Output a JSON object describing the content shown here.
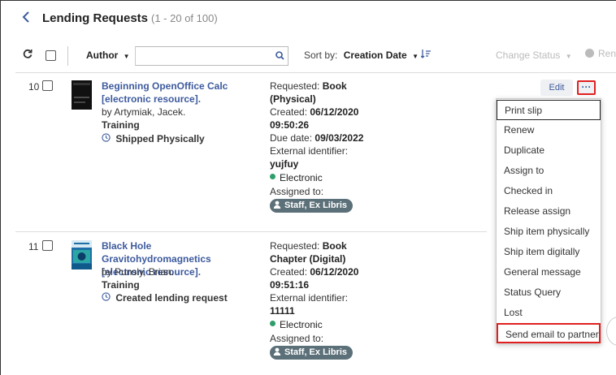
{
  "header": {
    "title": "Lending Requests",
    "count": "(1 - 20 of 100)"
  },
  "toolbar": {
    "author_label": "Author",
    "search_placeholder": "",
    "sort_by_label": "Sort by:",
    "sort_by_value": "Creation Date",
    "change_status_label": "Change Status",
    "ren_label": "Ren"
  },
  "rows": [
    {
      "number": "10",
      "title_line1": "Beginning OpenOffice Calc",
      "title_line2": "[electronic resource].",
      "by_label": "by",
      "author": "Artymiak, Jacek.",
      "department": "Training",
      "status": "Shipped Physically",
      "requested_label": "Requested:",
      "requested_line1": "Book",
      "requested_line2": "(Physical)",
      "created_label": "Created:",
      "created_date": "06/12/2020",
      "created_time": "09:50:26",
      "due_label": "Due date:",
      "due_date": "09/03/2022",
      "ext_id_label": "External identifier:",
      "ext_id": "yujfuy",
      "format": "Electronic",
      "assigned_label": "Assigned to:",
      "assignee": "Staff, Ex Libris"
    },
    {
      "number": "11",
      "title_line1": "Black Hole Gravitohydromagnetics",
      "title_line2": "[electronic resource].",
      "by_label": "by",
      "author": "Punsly, Brian.",
      "department": "Training",
      "status": "Created lending request",
      "requested_label": "Requested:",
      "requested_line1": "Book",
      "requested_line2": "Chapter (Digital)",
      "created_label": "Created:",
      "created_date": "06/12/2020",
      "created_time": "09:51:16",
      "ext_id_label": "External identifier:",
      "ext_id": "11111",
      "format": "Electronic",
      "assigned_label": "Assigned to:",
      "assignee": "Staff, Ex Libris"
    }
  ],
  "actions": {
    "edit_label": "Edit",
    "more_label": "···"
  },
  "menu": {
    "items": [
      "Print slip",
      "Renew",
      "Duplicate",
      "Assign to",
      "Checked in",
      "Release assign",
      "Ship item physically",
      "Ship item digitally",
      "General message",
      "Status Query",
      "Lost",
      "Send email to partner"
    ]
  },
  "colors": {
    "link": "#3d5a9e",
    "highlight": "#e02020",
    "pill": "#5c7079",
    "electronic_dot": "#2e9e6b"
  }
}
